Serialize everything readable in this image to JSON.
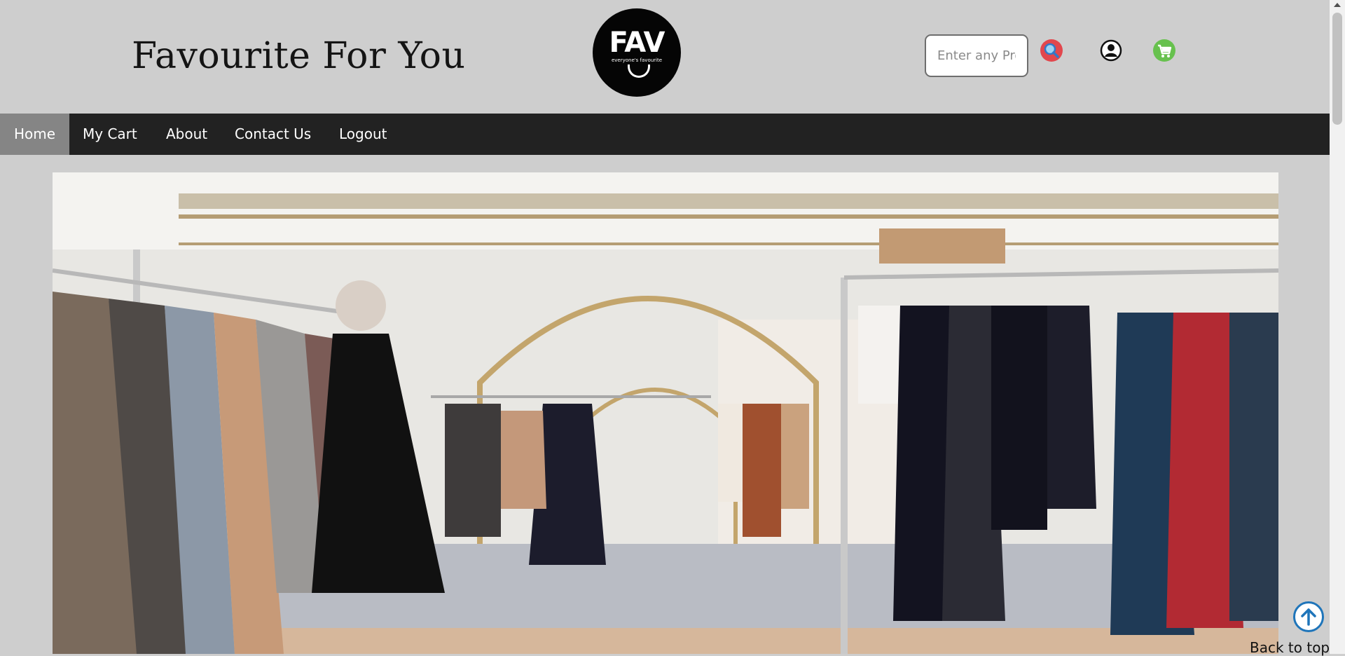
{
  "header": {
    "title": "Favourite For You",
    "logo": {
      "mark": "FAV",
      "tagline": "everyone's favourite"
    },
    "search": {
      "placeholder": "Enter any Product"
    },
    "icons": {
      "search": "search-icon",
      "user": "user-icon",
      "cart": "cart-icon"
    }
  },
  "nav": {
    "items": [
      {
        "label": "Home",
        "active": true
      },
      {
        "label": "My Cart",
        "active": false
      },
      {
        "label": "About",
        "active": false
      },
      {
        "label": "Contact Us",
        "active": false
      },
      {
        "label": "Logout",
        "active": false
      }
    ]
  },
  "footer": {
    "back_to_top": "Back to top"
  },
  "colors": {
    "page_bg": "#cecece",
    "navbar_bg": "#222222",
    "nav_active_bg": "#858585",
    "search_btn": "#e2474d",
    "cart_btn": "#67c14e",
    "back_top_accent": "#1f75ba"
  }
}
